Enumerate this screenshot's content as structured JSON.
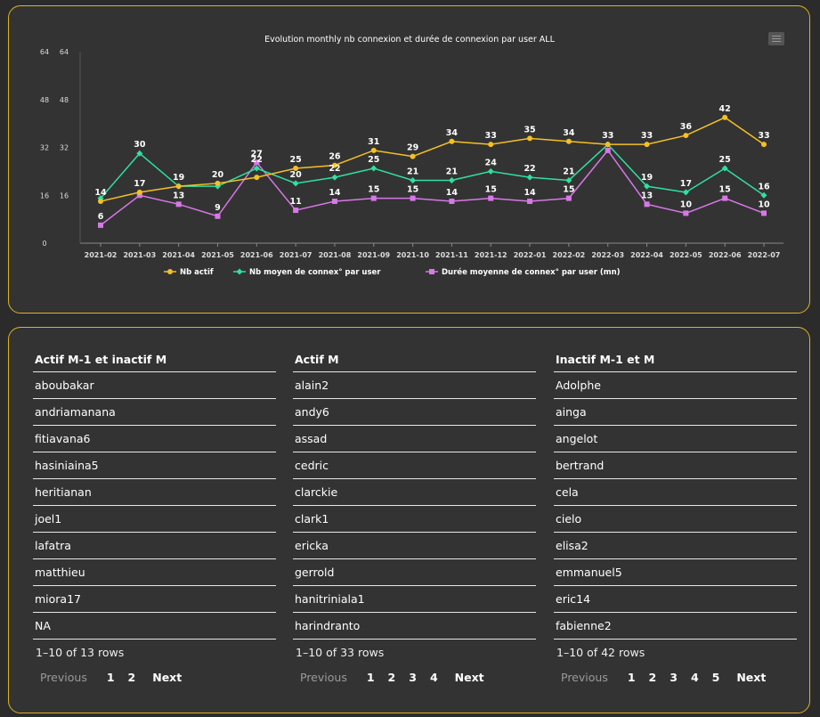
{
  "chart_data": {
    "type": "line",
    "title": "Evolution monthly nb connexion et durée de connexion par user ALL",
    "x": [
      "2021-02",
      "2021-03",
      "2021-04",
      "2021-05",
      "2021-06",
      "2021-07",
      "2021-08",
      "2021-09",
      "2021-10",
      "2021-11",
      "2021-12",
      "2022-01",
      "2022-02",
      "2022-03",
      "2022-04",
      "2022-05",
      "2022-06",
      "2022-07"
    ],
    "ylim": [
      0,
      64
    ],
    "yticks_left": [
      "64",
      "48",
      "32",
      "16",
      "0"
    ],
    "yticks_right": [
      "64",
      "48",
      "32",
      "16"
    ],
    "series": [
      {
        "name": "Nb actif",
        "color": "#f4c025",
        "marker": "circle",
        "values": [
          14,
          17,
          19,
          20,
          22,
          25,
          26,
          31,
          29,
          34,
          33,
          35,
          34,
          33,
          33,
          36,
          42,
          33
        ],
        "labels": [
          "14",
          "17",
          "",
          "20",
          "",
          "25",
          "26",
          "31",
          "29",
          "34",
          "33",
          "35",
          "34",
          "33",
          "33",
          "36",
          "42",
          "33"
        ]
      },
      {
        "name": "Nb moyen de connex° par user",
        "color": "#2fe0a0",
        "marker": "diamond",
        "values": [
          15,
          30,
          19,
          19,
          25,
          20,
          22,
          25,
          21,
          21,
          24,
          22,
          21,
          33,
          19,
          17,
          25,
          16
        ],
        "labels": [
          "",
          "30",
          "19",
          "",
          "22",
          "20",
          "22",
          "25",
          "21",
          "21",
          "24",
          "22",
          "21",
          "",
          "19",
          "17",
          "25",
          "16"
        ]
      },
      {
        "name": "Durée moyenne de connex° par user (mn)",
        "color": "#d878e8",
        "marker": "square",
        "values": [
          6,
          16,
          13,
          9,
          27,
          11,
          14,
          15,
          15,
          14,
          15,
          14,
          15,
          31,
          13,
          10,
          15,
          10
        ],
        "labels": [
          "6",
          "",
          "13",
          "9",
          "27",
          "11",
          "14",
          "15",
          "15",
          "14",
          "15",
          "14",
          "15",
          "",
          "13",
          "10",
          "15",
          "10"
        ]
      }
    ],
    "legend_position": "bottom",
    "grid": false
  },
  "tables": [
    {
      "header": "Actif M-1 et inactif M",
      "rows": [
        "aboubakar",
        "andriamanana",
        "fitiavana6",
        "hasiniaina5",
        "heritianan",
        "joel1",
        "lafatra",
        "matthieu",
        "miora17",
        "NA"
      ],
      "info": "1–10 of 13 rows",
      "prev": "Previous",
      "pages": [
        "1",
        "2"
      ],
      "next": "Next"
    },
    {
      "header": "Actif M",
      "rows": [
        "alain2",
        "andy6",
        "assad",
        "cedric",
        "clarckie",
        "clark1",
        "ericka",
        "gerrold",
        "hanitriniala1",
        "harindranto"
      ],
      "info": "1–10 of 33 rows",
      "prev": "Previous",
      "pages": [
        "1",
        "2",
        "3",
        "4"
      ],
      "next": "Next"
    },
    {
      "header": "Inactif M-1 et M",
      "rows": [
        "Adolphe",
        "ainga",
        "angelot",
        "bertrand",
        "cela",
        "cielo",
        "elisa2",
        "emmanuel5",
        "eric14",
        "fabienne2"
      ],
      "info": "1–10 of 42 rows",
      "prev": "Previous",
      "pages": [
        "1",
        "2",
        "3",
        "4",
        "5"
      ],
      "next": "Next"
    }
  ]
}
